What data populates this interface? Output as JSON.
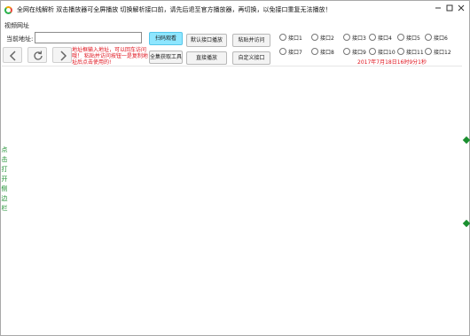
{
  "window": {
    "title": "全网在线解析  双击播放器可全屏播放  切换解析接口前，请先后退至官方播放器，再切换，以免接口重复无法播放！"
  },
  "menu": {
    "item": "视频网址"
  },
  "toolbar": {
    "url_label": "当前地址:",
    "url_value": "",
    "note": "地址框输入地址，可以回车访问哦！ 粘贴并访问按钮一是复制地址后点击使用的!",
    "buttons": {
      "scan": "扫码观看",
      "capture": "全集获取工具",
      "default_api": "默认接口播放",
      "direct": "直接播放",
      "paste_visit": "粘贴并访问",
      "custom_api": "自定义接口"
    },
    "interfaces": [
      "接口1",
      "接口2",
      "接口3",
      "接口4",
      "接口5",
      "接口6",
      "接口7",
      "接口8",
      "接口9",
      "接口10",
      "接口11",
      "接口12"
    ],
    "datetime": "2017年7月18日16时9分1秒"
  },
  "side_panel": {
    "text": "点击打开侧边栏"
  },
  "colors": {
    "accent_button": "#8ee6ff",
    "warning_text": "#e0141e",
    "side_panel": "#1a8f2f"
  }
}
